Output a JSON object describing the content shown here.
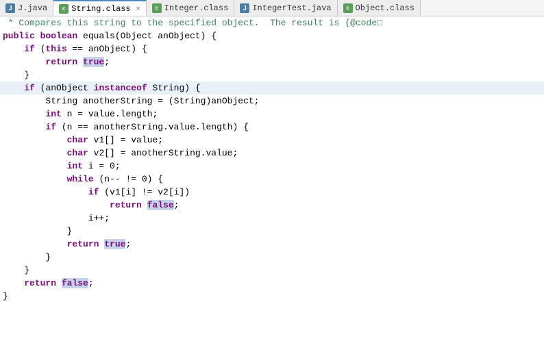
{
  "tabs": [
    {
      "id": "tab-java",
      "label": "J.java",
      "icon": "j-icon",
      "active": false,
      "closeable": false
    },
    {
      "id": "tab-string-class",
      "label": "String.class",
      "icon": "class-icon",
      "active": true,
      "closeable": true
    },
    {
      "id": "tab-integer-class",
      "label": "Integer.class",
      "icon": "class-icon",
      "active": false,
      "closeable": false
    },
    {
      "id": "tab-integertest-java",
      "label": "IntegerTest.java",
      "icon": "j-icon",
      "active": false,
      "closeable": false
    },
    {
      "id": "tab-object-class",
      "label": "Object.class",
      "icon": "class-icon",
      "active": false,
      "closeable": false
    }
  ],
  "code": {
    "lines": [
      {
        "id": 1,
        "highlighted": false,
        "content": " * Compares this string to the specified object.  The result is {@code□"
      },
      {
        "id": 2,
        "highlighted": false,
        "content": "public boolean equals(Object anObject) {"
      },
      {
        "id": 3,
        "highlighted": false,
        "content": "    if (this == anObject) {"
      },
      {
        "id": 4,
        "highlighted": false,
        "content": "        return true;"
      },
      {
        "id": 5,
        "highlighted": false,
        "content": "    }"
      },
      {
        "id": 6,
        "highlighted": true,
        "content": "    if (anObject instanceof String) {"
      },
      {
        "id": 7,
        "highlighted": false,
        "content": "        String anotherString = (String)anObject;"
      },
      {
        "id": 8,
        "highlighted": false,
        "content": "        int n = value.length;"
      },
      {
        "id": 9,
        "highlighted": false,
        "content": "        if (n == anotherString.value.length) {"
      },
      {
        "id": 10,
        "highlighted": false,
        "content": "            char v1[] = value;"
      },
      {
        "id": 11,
        "highlighted": false,
        "content": "            char v2[] = anotherString.value;"
      },
      {
        "id": 12,
        "highlighted": false,
        "content": "            int i = 0;"
      },
      {
        "id": 13,
        "highlighted": false,
        "content": "            while (n-- != 0) {"
      },
      {
        "id": 14,
        "highlighted": false,
        "content": "                if (v1[i] != v2[i])"
      },
      {
        "id": 15,
        "highlighted": false,
        "content": "                    return false;"
      },
      {
        "id": 16,
        "highlighted": false,
        "content": "                i++;"
      },
      {
        "id": 17,
        "highlighted": false,
        "content": "            }"
      },
      {
        "id": 18,
        "highlighted": false,
        "content": "            return true;"
      },
      {
        "id": 19,
        "highlighted": false,
        "content": "        }"
      },
      {
        "id": 20,
        "highlighted": false,
        "content": "    }"
      },
      {
        "id": 21,
        "highlighted": false,
        "content": "    return false;"
      },
      {
        "id": 22,
        "highlighted": false,
        "content": "}"
      }
    ]
  }
}
